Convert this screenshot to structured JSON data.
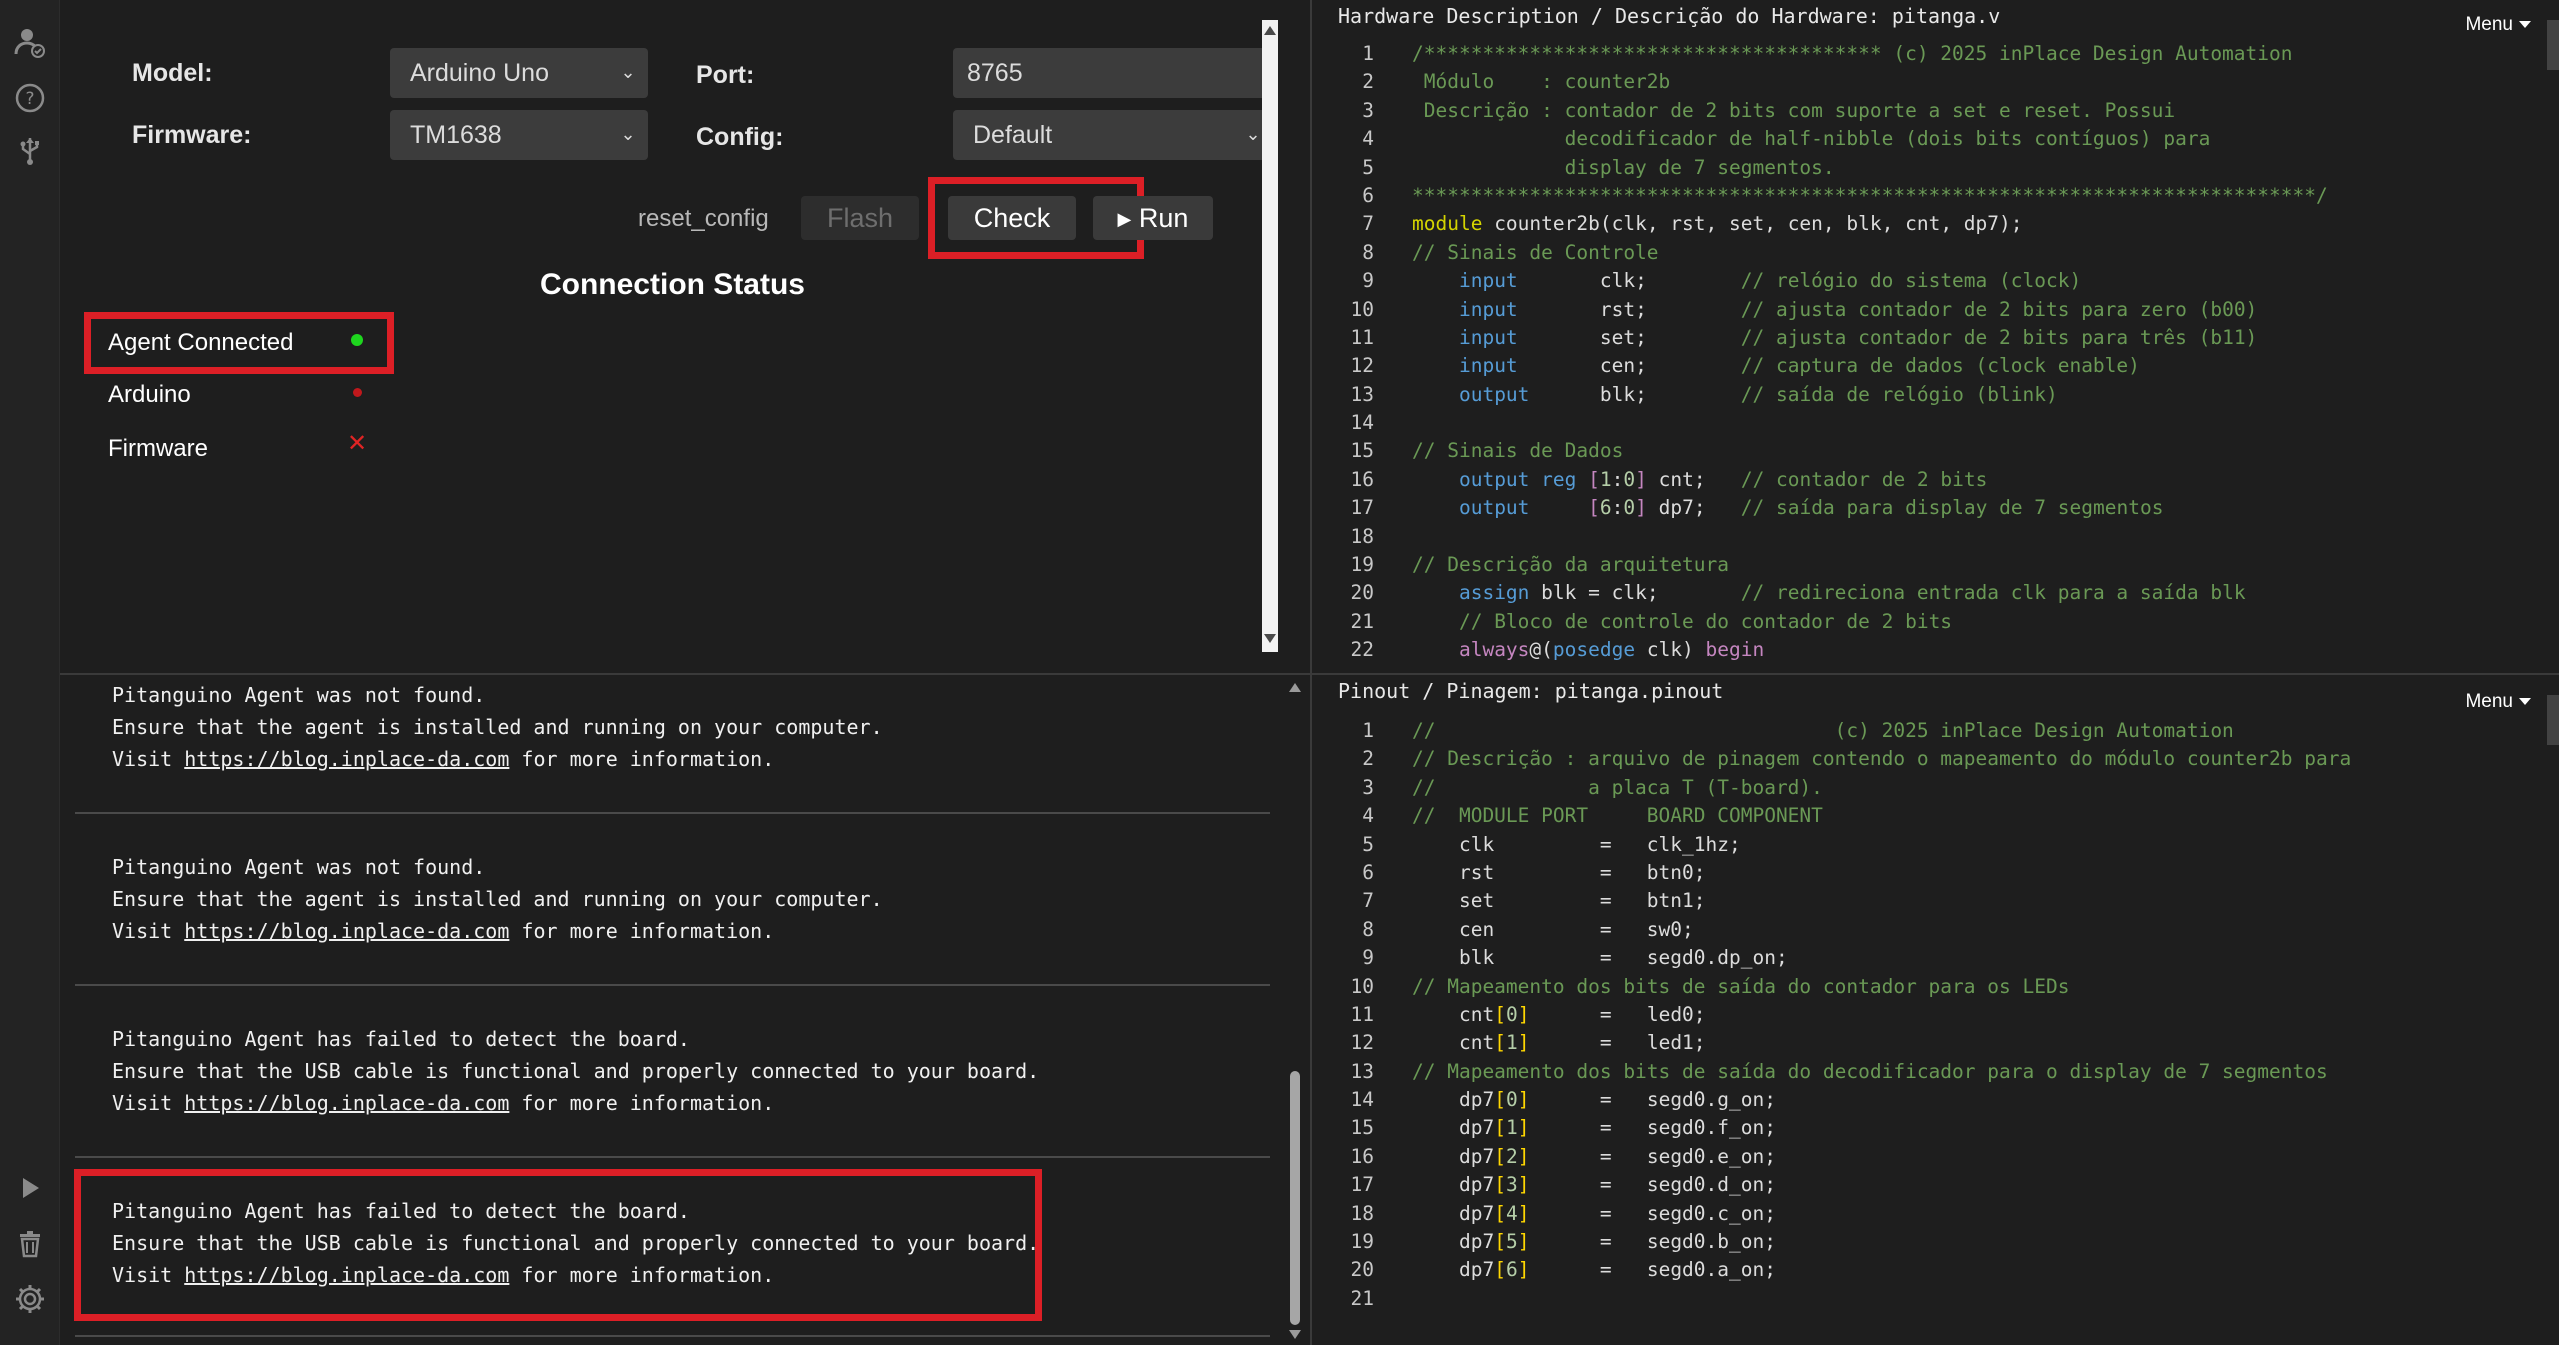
{
  "sidebar": {
    "icons": [
      "user-check-icon",
      "help-icon",
      "usb-icon",
      "play-icon",
      "trash-icon",
      "settings-icon"
    ]
  },
  "config": {
    "model_label": "Model:",
    "model_value": "Arduino Uno",
    "port_label": "Port:",
    "port_value": "8765",
    "firmware_label": "Firmware:",
    "firmware_value": "TM1638",
    "config_label": "Config:",
    "config_value": "Default",
    "reset_config": "reset_config",
    "flash_label": "Flash",
    "check_label": "Check",
    "run_label": "Run",
    "status_title": "Connection Status",
    "status": [
      {
        "label": "Agent Connected",
        "state": "ok",
        "color": "#1ed61e"
      },
      {
        "label": "Arduino",
        "state": "off",
        "color": "#c0181c"
      },
      {
        "label": "Firmware",
        "state": "fail",
        "color": "#e02424"
      }
    ]
  },
  "console": {
    "messages": [
      {
        "line1": "Pitanguino Agent was not found.",
        "line2": "Ensure that the agent is installed and running on your computer.",
        "pre": "Visit ",
        "link": "https://blog.inplace-da.com",
        "post": " for more information."
      },
      {
        "line1": "Pitanguino Agent was not found.",
        "line2": "Ensure that the agent is installed and running on your computer.",
        "pre": "Visit ",
        "link": "https://blog.inplace-da.com",
        "post": " for more information."
      },
      {
        "line1": "Pitanguino Agent has failed to detect the board.",
        "line2": "Ensure that the USB cable is functional and properly connected to your board.",
        "pre": "Visit ",
        "link": "https://blog.inplace-da.com",
        "post": " for more information."
      },
      {
        "line1": "Pitanguino Agent has failed to detect the board.",
        "line2": "Ensure that the USB cable is functional and properly connected to your board.",
        "pre": "Visit ",
        "link": "https://blog.inplace-da.com",
        "post": " for more information."
      }
    ]
  },
  "hw_editor": {
    "title": "Hardware Description / Descrição do Hardware: pitanga.v",
    "menu": "Menu",
    "lines": [
      [
        [
          "com",
          "/*************************************** (c) 2025 inPlace Design Automation"
        ]
      ],
      [
        [
          "com",
          " Módulo    : counter2b"
        ]
      ],
      [
        [
          "com",
          " Descrição : contador de 2 bits com suporte a set e reset. Possui"
        ]
      ],
      [
        [
          "com",
          "             decodificador de half-nibble (dois bits contíguos) para"
        ]
      ],
      [
        [
          "com",
          "             display de 7 segmentos."
        ]
      ],
      [
        [
          "com",
          "*****************************************************************************/"
        ]
      ],
      [
        [
          "mod",
          "module"
        ],
        [
          "pl",
          " counter2b(clk, rst, set, cen, blk, cnt, dp7);"
        ]
      ],
      [
        [
          "com",
          "// Sinais de Controle"
        ]
      ],
      [
        [
          "pl",
          "    "
        ],
        [
          "kw",
          "input"
        ],
        [
          "pl",
          "       clk;        "
        ],
        [
          "com",
          "// relógio do sistema (clock)"
        ]
      ],
      [
        [
          "pl",
          "    "
        ],
        [
          "kw",
          "input"
        ],
        [
          "pl",
          "       rst;        "
        ],
        [
          "com",
          "// ajusta contador de 2 bits para zero (b00)"
        ]
      ],
      [
        [
          "pl",
          "    "
        ],
        [
          "kw",
          "input"
        ],
        [
          "pl",
          "       set;        "
        ],
        [
          "com",
          "// ajusta contador de 2 bits para três (b11)"
        ]
      ],
      [
        [
          "pl",
          "    "
        ],
        [
          "kw",
          "input"
        ],
        [
          "pl",
          "       cen;        "
        ],
        [
          "com",
          "// captura de dados (clock enable)"
        ]
      ],
      [
        [
          "pl",
          "    "
        ],
        [
          "kw",
          "output"
        ],
        [
          "pl",
          "      blk;        "
        ],
        [
          "com",
          "// saída de relógio (blink)"
        ]
      ],
      [],
      [
        [
          "com",
          "// Sinais de Dados"
        ]
      ],
      [
        [
          "pl",
          "    "
        ],
        [
          "kw",
          "output"
        ],
        [
          "pl",
          " "
        ],
        [
          "kw",
          "reg"
        ],
        [
          "pl",
          " "
        ],
        [
          "ctrl",
          "["
        ],
        [
          "num",
          "1"
        ],
        [
          "pl",
          ":"
        ],
        [
          "num",
          "0"
        ],
        [
          "ctrl",
          "]"
        ],
        [
          "pl",
          " cnt;   "
        ],
        [
          "com",
          "// contador de 2 bits"
        ]
      ],
      [
        [
          "pl",
          "    "
        ],
        [
          "kw",
          "output"
        ],
        [
          "pl",
          "     "
        ],
        [
          "ctrl",
          "["
        ],
        [
          "num",
          "6"
        ],
        [
          "pl",
          ":"
        ],
        [
          "num",
          "0"
        ],
        [
          "ctrl",
          "]"
        ],
        [
          "pl",
          " dp7;   "
        ],
        [
          "com",
          "// saída para display de 7 segmentos"
        ]
      ],
      [],
      [
        [
          "com",
          "// Descrição da arquitetura"
        ]
      ],
      [
        [
          "pl",
          "    "
        ],
        [
          "kw",
          "assign"
        ],
        [
          "pl",
          " blk = clk;       "
        ],
        [
          "com",
          "// redireciona entrada clk para a saída blk"
        ]
      ],
      [
        [
          "pl",
          "    "
        ],
        [
          "com",
          "// Bloco de controle do contador de 2 bits"
        ]
      ],
      [
        [
          "pl",
          "    "
        ],
        [
          "ctrl",
          "always"
        ],
        [
          "pl",
          "@("
        ],
        [
          "kw",
          "posedge"
        ],
        [
          "pl",
          " clk) "
        ],
        [
          "ctrl",
          "begin"
        ]
      ]
    ]
  },
  "pin_editor": {
    "title": "Pinout / Pinagem: pitanga.pinout",
    "menu": "Menu",
    "lines": [
      [
        [
          "com",
          "//                                  (c) 2025 inPlace Design Automation"
        ]
      ],
      [
        [
          "com",
          "// Descrição : arquivo de pinagem contendo o mapeamento do módulo counter2b para"
        ]
      ],
      [
        [
          "com",
          "//             a placa T (T-board)."
        ]
      ],
      [
        [
          "com",
          "//  MODULE PORT     BOARD COMPONENT"
        ]
      ],
      [
        [
          "pl",
          "    clk         =   clk_1hz;"
        ]
      ],
      [
        [
          "pl",
          "    rst         =   btn0;"
        ]
      ],
      [
        [
          "pl",
          "    set         =   btn1;"
        ]
      ],
      [
        [
          "pl",
          "    cen         =   sw0;"
        ]
      ],
      [
        [
          "pl",
          "    blk         =   segd0.dp_on;"
        ]
      ],
      [
        [
          "com",
          "// Mapeamento dos bits de saída do contador para os LEDs"
        ]
      ],
      [
        [
          "pl",
          "    cnt"
        ],
        [
          "br",
          "["
        ],
        [
          "num",
          "0"
        ],
        [
          "br",
          "]"
        ],
        [
          "pl",
          "      =   led0;"
        ]
      ],
      [
        [
          "pl",
          "    cnt"
        ],
        [
          "br",
          "["
        ],
        [
          "num",
          "1"
        ],
        [
          "br",
          "]"
        ],
        [
          "pl",
          "      =   led1;"
        ]
      ],
      [
        [
          "com",
          "// Mapeamento dos bits de saída do decodificador para o display de 7 segmentos"
        ]
      ],
      [
        [
          "pl",
          "    dp7"
        ],
        [
          "br",
          "["
        ],
        [
          "num",
          "0"
        ],
        [
          "br",
          "]"
        ],
        [
          "pl",
          "      =   segd0.g_on;"
        ]
      ],
      [
        [
          "pl",
          "    dp7"
        ],
        [
          "br",
          "["
        ],
        [
          "num",
          "1"
        ],
        [
          "br",
          "]"
        ],
        [
          "pl",
          "      =   segd0.f_on;"
        ]
      ],
      [
        [
          "pl",
          "    dp7"
        ],
        [
          "br",
          "["
        ],
        [
          "num",
          "2"
        ],
        [
          "br",
          "]"
        ],
        [
          "pl",
          "      =   segd0.e_on;"
        ]
      ],
      [
        [
          "pl",
          "    dp7"
        ],
        [
          "br",
          "["
        ],
        [
          "num",
          "3"
        ],
        [
          "br",
          "]"
        ],
        [
          "pl",
          "      =   segd0.d_on;"
        ]
      ],
      [
        [
          "pl",
          "    dp7"
        ],
        [
          "br",
          "["
        ],
        [
          "num",
          "4"
        ],
        [
          "br",
          "]"
        ],
        [
          "pl",
          "      =   segd0.c_on;"
        ]
      ],
      [
        [
          "pl",
          "    dp7"
        ],
        [
          "br",
          "["
        ],
        [
          "num",
          "5"
        ],
        [
          "br",
          "]"
        ],
        [
          "pl",
          "      =   segd0.b_on;"
        ]
      ],
      [
        [
          "pl",
          "    dp7"
        ],
        [
          "br",
          "["
        ],
        [
          "num",
          "6"
        ],
        [
          "br",
          "]"
        ],
        [
          "pl",
          "      =   segd0.a_on;"
        ]
      ],
      []
    ]
  }
}
